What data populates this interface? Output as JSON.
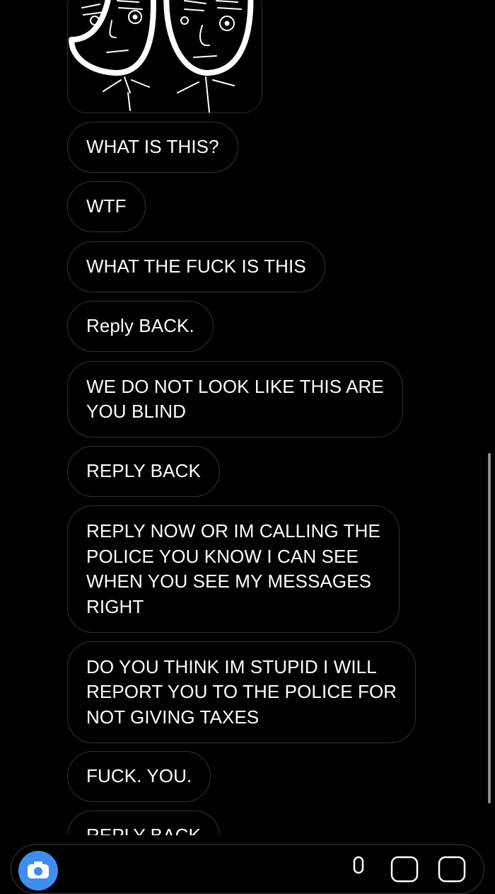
{
  "messages": [
    {
      "text": "WHAT IS THIS?"
    },
    {
      "text": "WTF"
    },
    {
      "text": "WHAT THE FUCK IS THIS"
    },
    {
      "text": "Reply BACK."
    },
    {
      "text": "WE DO NOT LOOK LIKE THIS ARE\nYOU BLIND"
    },
    {
      "text": "REPLY BACK"
    },
    {
      "text": "REPLY NOW OR IM CALLING THE\nPOLICE YOU KNOW I CAN SEE\nWHEN YOU SEE MY MESSAGES\nRIGHT"
    },
    {
      "text": "DO YOU THINK IM STUPID I WILL\nREPORT YOU TO THE POLICE FOR\nNOT GIVING TAXES"
    },
    {
      "text": "FUCK. YOU."
    },
    {
      "text": "REPLY BACK"
    }
  ],
  "composer": {
    "camera_icon": "camera-icon",
    "mic_icon": "microphone-icon",
    "gallery_icon": "gallery-icon",
    "sticker_icon": "sticker-icon",
    "accent_color": "#3d8ef0"
  },
  "colors": {
    "background": "#000000",
    "bubble_border": "#333333",
    "text": "#ffffff"
  }
}
